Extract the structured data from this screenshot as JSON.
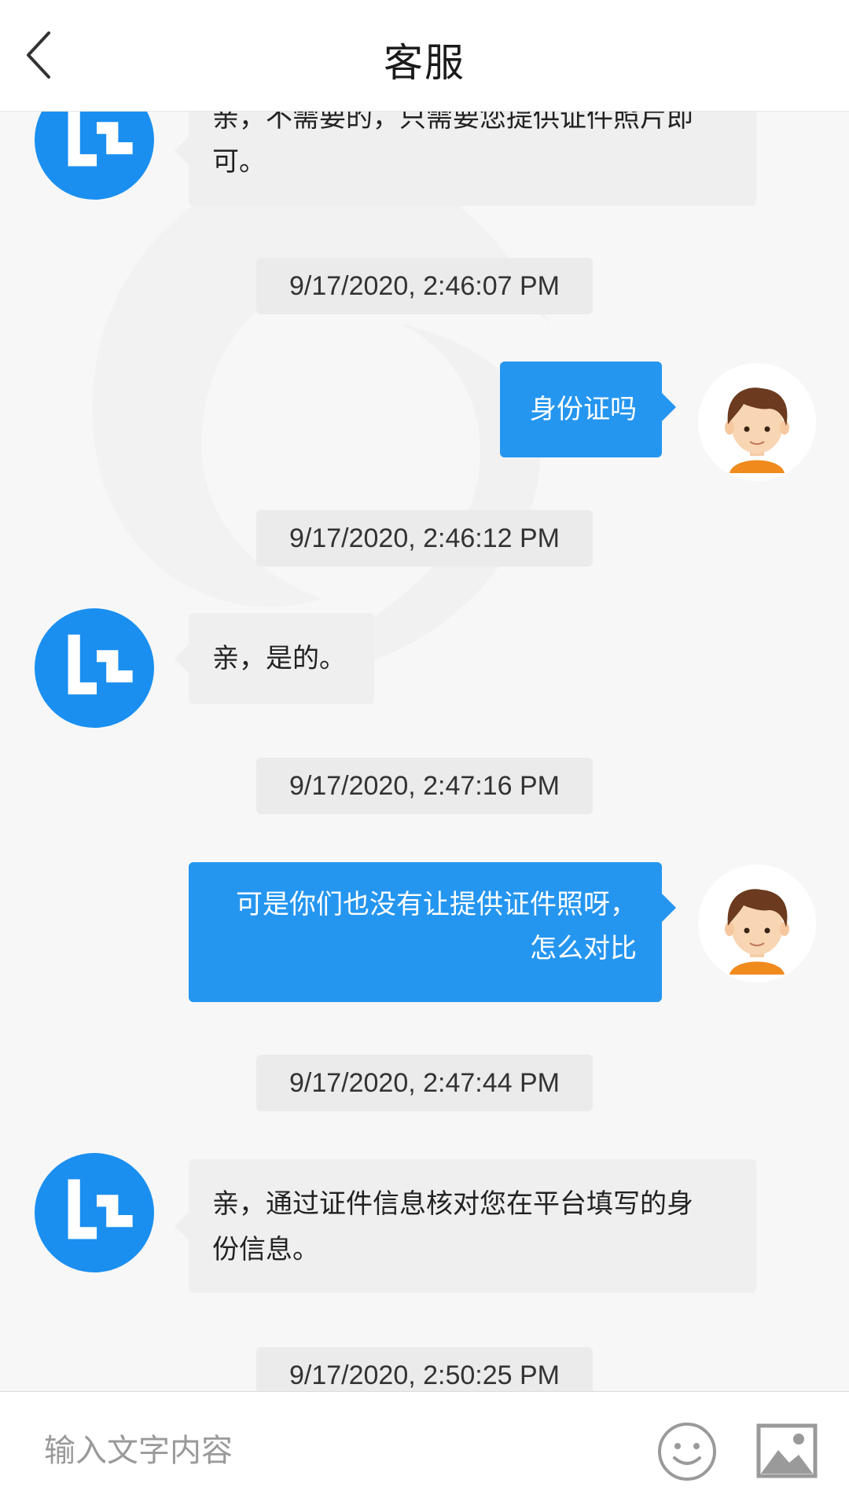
{
  "header": {
    "title": "客服"
  },
  "messages": [
    {
      "time": "9/17/2020, 2:46:07 PM",
      "user_text": "身份证吗"
    },
    {
      "time": "9/17/2020, 2:46:12 PM",
      "agent_text": "亲，是的。"
    },
    {
      "time": "9/17/2020, 2:47:16 PM",
      "user_line1": "可是你们也没有让提供证件照呀，",
      "user_line2": "怎么对比"
    },
    {
      "time": "9/17/2020, 2:47:44 PM",
      "agent_line1": "亲，通过证件信息核对您在平台填写的身",
      "agent_line2": "份信息。"
    },
    {
      "time": "9/17/2020, 2:50:25 PM"
    }
  ],
  "top_partial": {
    "line1": "亲，不需要的，只需要您提供证件照片即",
    "line2": "可。"
  },
  "input": {
    "placeholder": "输入文字内容"
  },
  "icons": {
    "back": "chevron-left-icon",
    "emoji": "smiley-icon",
    "image": "image-icon"
  },
  "colors": {
    "accent": "#2596f0",
    "user_avatar_shirt": "#f08a1c"
  }
}
